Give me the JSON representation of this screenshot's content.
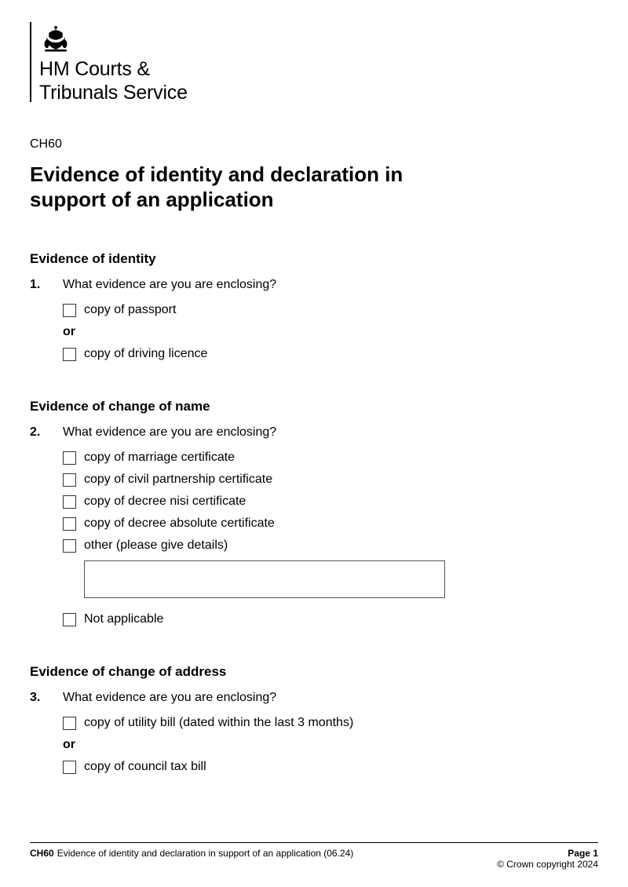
{
  "header": {
    "org_line1": "HM Courts &",
    "org_line2": "Tribunals Service",
    "form_code": "CH60",
    "title": "Evidence of identity and declaration in support of an application"
  },
  "sections": {
    "identity": {
      "heading": "Evidence of identity",
      "num": "1.",
      "question": "What evidence are you are enclosing?",
      "opt_passport": "copy of passport",
      "or": "or",
      "opt_driving": "copy of driving licence"
    },
    "name_change": {
      "heading": "Evidence of change of name",
      "num": "2.",
      "question": "What evidence are you are enclosing?",
      "opt_marriage": "copy of marriage certificate",
      "opt_civil": "copy of civil partnership certificate",
      "opt_nisi": "copy of decree nisi certificate",
      "opt_absolute": "copy of decree absolute certificate",
      "opt_other": "other (please give details)",
      "opt_na": "Not applicable"
    },
    "address_change": {
      "heading": "Evidence of change of address",
      "num": "3.",
      "question": "What evidence are you are enclosing?",
      "opt_utility": "copy of utility bill (dated within the last 3 months)",
      "or": "or",
      "opt_council": "copy of council tax bill"
    }
  },
  "footer": {
    "code": "CH60",
    "desc": "Evidence of identity and declaration in support of an application (06.24)",
    "page": "Page 1",
    "copyright": "© Crown copyright 2024"
  }
}
